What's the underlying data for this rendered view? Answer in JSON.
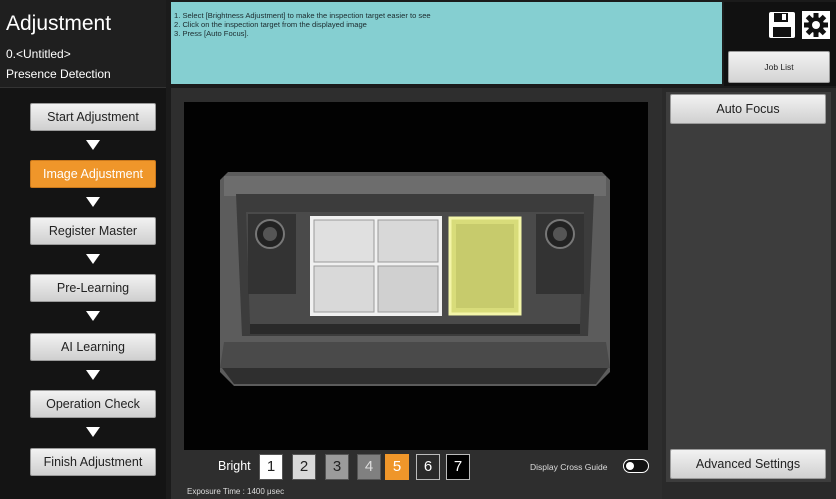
{
  "header": {
    "title": "Adjustment",
    "job_name": "0.<Untitled>",
    "mode": "Presence Detection"
  },
  "steps": [
    {
      "label": "Start Adjustment",
      "active": false
    },
    {
      "label": "Image Adjustment",
      "active": true
    },
    {
      "label": "Register Master",
      "active": false
    },
    {
      "label": "Pre-Learning",
      "active": false
    },
    {
      "label": "AI Learning",
      "active": false
    },
    {
      "label": "Operation Check",
      "active": false
    },
    {
      "label": "Finish Adjustment",
      "active": false
    }
  ],
  "instructions": [
    "1. Select [Brightness Adjustment] to make the inspection target easier to see",
    "2. Click on the inspection target from the displayed image",
    "3. Press [Auto Focus]."
  ],
  "toolbar": {
    "save_icon": "save-icon",
    "settings_icon": "gear-icon",
    "job_list_label": "Job List"
  },
  "brightness": {
    "label": "Bright",
    "levels": [
      "1",
      "2",
      "3",
      "4",
      "5",
      "6",
      "7"
    ],
    "selected": "5"
  },
  "cross_guide": {
    "label": "Display Cross Guide",
    "enabled": false
  },
  "exposure_text": "Exposure Time : 1400 μsec",
  "right_panel": {
    "auto_focus_label": "Auto Focus",
    "advanced_settings_label": "Advanced Settings"
  },
  "colors": {
    "accent_active": "#ef962a",
    "instruction_bg": "#85cfd1",
    "selection_highlight": "#e8ec96"
  }
}
